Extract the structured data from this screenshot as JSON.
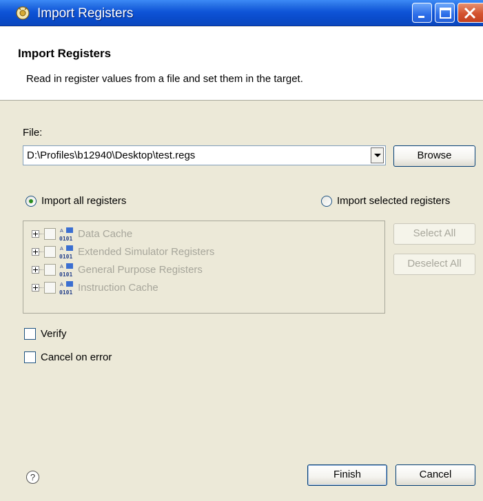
{
  "window": {
    "title": "Import Registers",
    "app_icon": "register-import-icon"
  },
  "header": {
    "title": "Import Registers",
    "description": "Read in register values from a file and set them in the target."
  },
  "file": {
    "label": "File:",
    "value": "D:\\Profiles\\b12940\\Desktop\\test.regs",
    "browse_label": "Browse"
  },
  "import_mode": {
    "all_label": "Import all registers",
    "selected_label": "Import selected registers",
    "selected": "all"
  },
  "register_groups": [
    {
      "label": "Data Cache",
      "checked": false
    },
    {
      "label": "Extended Simulator Registers",
      "checked": false
    },
    {
      "label": "General Purpose Registers",
      "checked": false
    },
    {
      "label": "Instruction Cache",
      "checked": false
    }
  ],
  "buttons": {
    "select_all": "Select All",
    "deselect_all": "Deselect All",
    "finish": "Finish",
    "cancel": "Cancel"
  },
  "options": {
    "verify_label": "Verify",
    "verify_checked": false,
    "cancel_on_error_label": "Cancel on error",
    "cancel_on_error_checked": false
  },
  "help_icon": "help-icon",
  "colors": {
    "titlebar": "#0a4ccc",
    "dialog_bg": "#ece9d8",
    "disabled_text": "#a7a69b"
  }
}
